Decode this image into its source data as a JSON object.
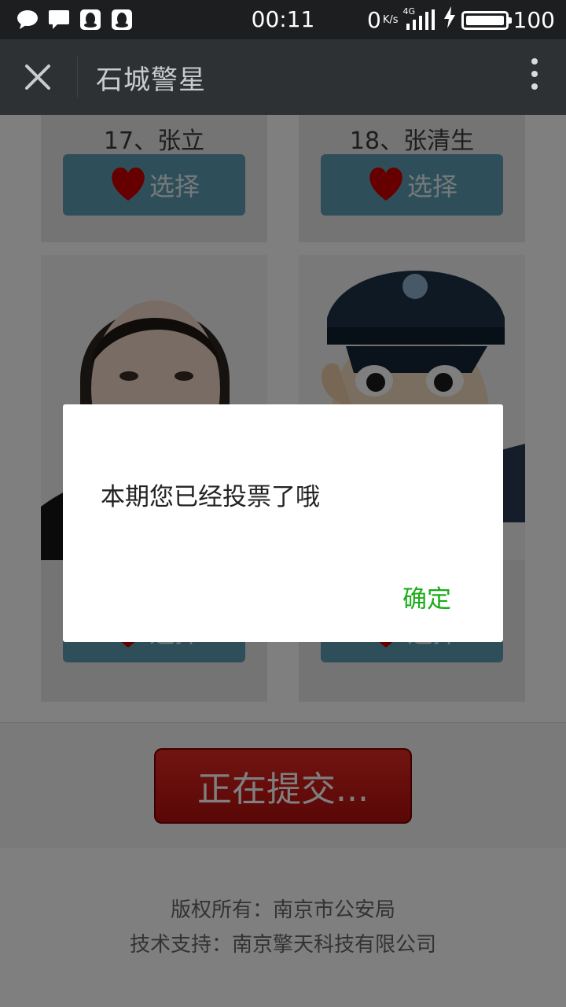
{
  "status_bar": {
    "time": "00:11",
    "net_speed": "0",
    "net_unit": "K/s",
    "network": "4G",
    "battery": "100",
    "battery_level": 1.0,
    "left_icons": [
      "wechat-message-icon",
      "chat-bubble-icon",
      "qq-icon",
      "qq-icon"
    ]
  },
  "titlebar": {
    "title": "石城警星",
    "close_icon": "close-icon",
    "more_icon": "more-vertical-icon"
  },
  "candidates": [
    {
      "name": "17、张立",
      "button": "选择"
    },
    {
      "name": "18、张清生",
      "button": "选择"
    },
    {
      "name": "",
      "button": "选择"
    },
    {
      "name": "",
      "button": "选择"
    }
  ],
  "submit": {
    "label": "正在提交..."
  },
  "footer": {
    "copyright": "版权所有：南京市公安局",
    "support": "技术支持：南京擎天科技有限公司"
  },
  "dialog": {
    "message": "本期您已经投票了哦",
    "ok_label": "确定"
  },
  "colors": {
    "accent_green": "#1aad19",
    "button_blue": "#5c9fb2",
    "submit_red": "#c8191a",
    "heart_red": "#cc0000"
  }
}
